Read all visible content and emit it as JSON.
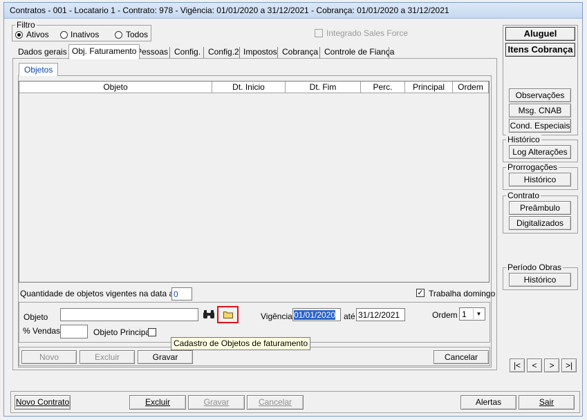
{
  "window": {
    "title": "Contratos - 001 - Locatario 1 - Contrato: 978 - Vigência: 01/01/2020 a 31/12/2021 - Cobrança: 01/01/2020 a 31/12/2021"
  },
  "filter": {
    "legend": "Filtro",
    "options": [
      "Ativos",
      "Inativos",
      "Todos"
    ],
    "selected": "Ativos"
  },
  "integrado": {
    "label": "Integrado Sales Force",
    "checked": false
  },
  "tabs": [
    "Dados gerais",
    "Obj. Faturamento",
    "Pessoas",
    "Config.",
    "Config.2",
    "Impostos",
    "Cobrança",
    "Controle de Fiança"
  ],
  "active_tab": "Obj. Faturamento",
  "subtab": "Objetos",
  "table": {
    "columns": [
      "Objeto",
      "Dt. Inicio",
      "Dt. Fim",
      "Perc.",
      "Principal",
      "Ordem"
    ],
    "rows": []
  },
  "quantidade": {
    "label": "Quantidade de objetos vigentes na data atual",
    "value": "0"
  },
  "trabalha_domingo": {
    "label": "Trabalha domingo",
    "checked": true
  },
  "form": {
    "objeto_label": "Objeto",
    "objeto_value": "",
    "vigencia_label": "Vigência",
    "vigencia_inicio": "01/01/2020",
    "ate_label": "até",
    "vigencia_fim": "31/12/2021",
    "ordem_label": "Ordem",
    "ordem_value": "1",
    "vendas_label": "% Vendas",
    "vendas_value": "",
    "objeto_principal_label": "Objeto Principal",
    "objeto_principal_checked": false
  },
  "tooltip": "Cadastro de Objetos de faturamento",
  "inner_buttons": {
    "novo": "Novo",
    "excluir": "Excluir",
    "gravar": "Gravar",
    "cancelar": "Cancelar"
  },
  "side": {
    "aluguel": "Aluguel",
    "itens_cobranca": "Itens Cobrança",
    "observacoes": "Observações",
    "msg_cnab": "Msg. CNAB",
    "cond_especiais": "Cond. Especiais",
    "historico_legend": "Histórico",
    "log_alteracoes": "Log Alterações",
    "prorrogacoes_legend": "Prorrogações",
    "prorrogacoes_historico": "Histórico",
    "contrato_legend": "Contrato",
    "preambulo": "Preâmbulo",
    "digitalizados": "Digitalizados",
    "periodo_obras_legend": "Período Obras",
    "periodo_obras_historico": "Histórico"
  },
  "nav": {
    "first": "|<",
    "prev": "<",
    "next": ">",
    "last": ">|"
  },
  "bottom": {
    "novo_contrato": "Novo Contrato",
    "excluir": "Excluir",
    "gravar": "Gravar",
    "cancelar": "Cancelar",
    "alertas": "Alertas",
    "sair": "Sair"
  }
}
